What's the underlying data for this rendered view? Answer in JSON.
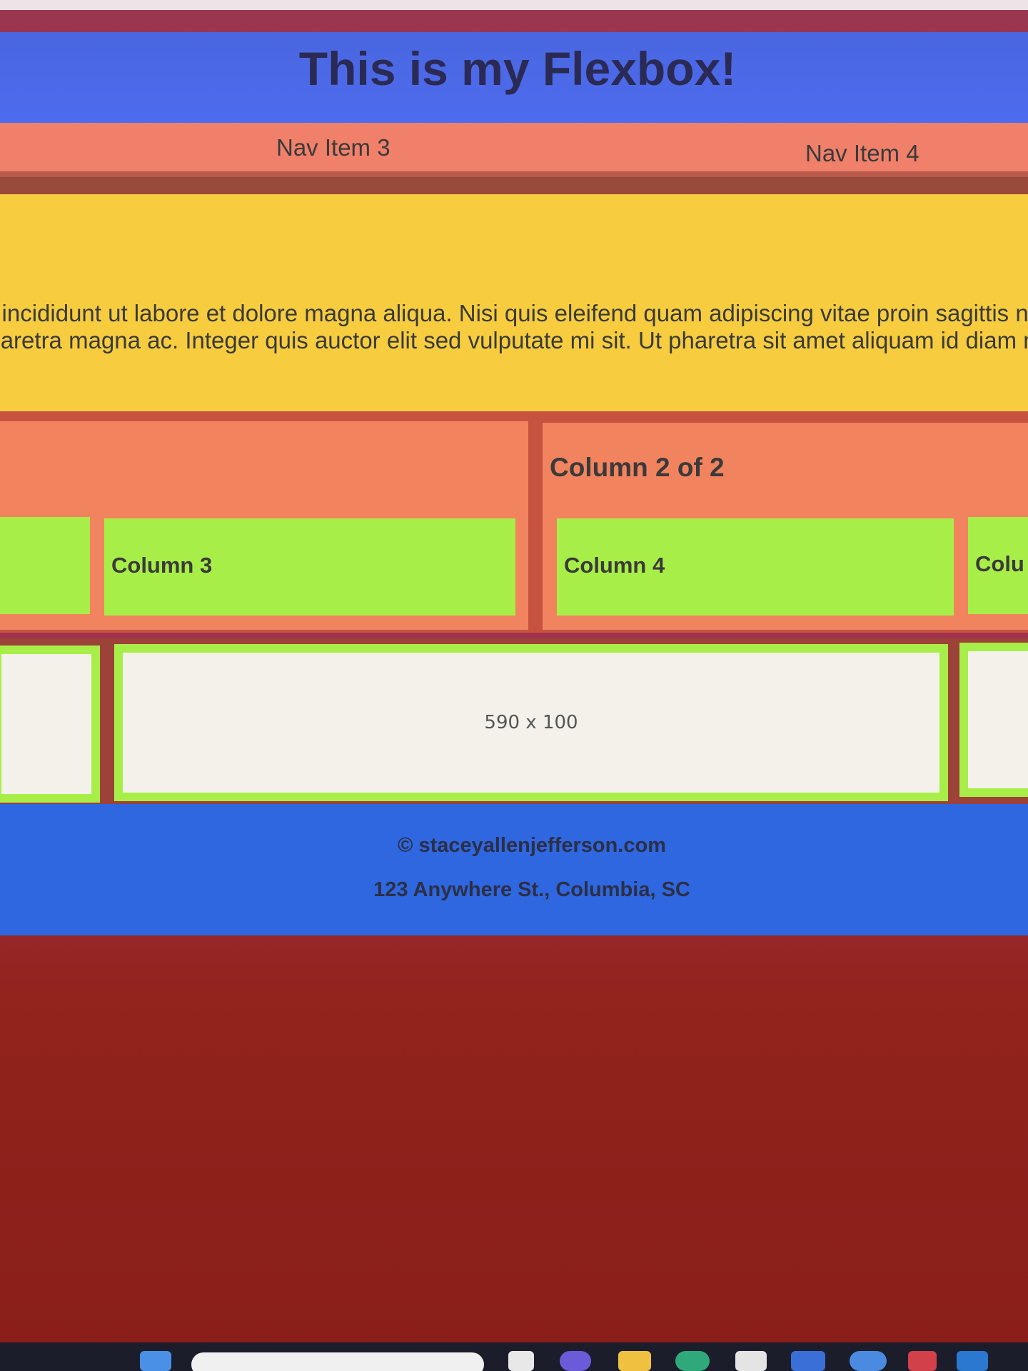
{
  "header": {
    "title": "This is my Flexbox!"
  },
  "nav": {
    "items": [
      "Nav Item 3",
      "Nav Item 4"
    ]
  },
  "hero": {
    "line1": "or incididunt ut labore et dolore magna aliqua. Nisi quis eleifend quam adipiscing vitae proin sagittis nis",
    "line2": " pharetra magna ac. Integer quis auctor elit sed vulputate mi sit. Ut pharetra sit amet aliquam id diam m"
  },
  "columns": {
    "col2_title": "Column 2 of 2",
    "c3": "Column 3",
    "c4": "Column 4",
    "c5": "Colu"
  },
  "image_placeholder": {
    "label": "590 x 100"
  },
  "footer": {
    "copyright": "© staceyallenjefferson.com",
    "address": "123 Anywhere St., Columbia, SC"
  },
  "colors": {
    "header": "#4d6cf0",
    "nav": "#f0806a",
    "hero": "#f7cd3f",
    "column": "#f2835f",
    "green": "#a8ee48",
    "footer": "#2f67e0",
    "background": "#9b3550"
  }
}
